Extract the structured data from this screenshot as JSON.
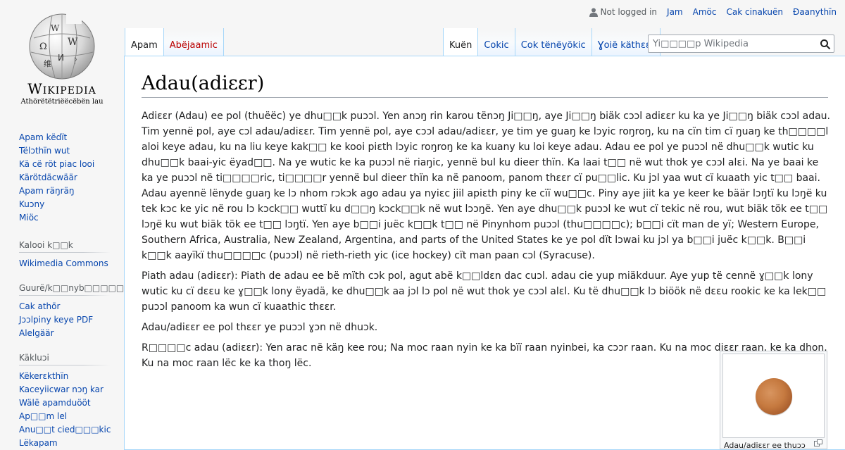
{
  "personal": {
    "not_logged_in": "Not logged in",
    "links": [
      "Jam",
      "Amöc",
      "Cak cinakuën",
      "Ɖaanythïn"
    ]
  },
  "logo": {
    "wordmark": "Wikipedia",
    "tagline": "Athörëtëtriëëcëbën lau"
  },
  "tabs": {
    "left": [
      {
        "label": "Apam",
        "selected": true,
        "new": false
      },
      {
        "label": "Abëjaamic",
        "selected": false,
        "new": true
      }
    ],
    "right": [
      {
        "label": "Kuën",
        "selected": true
      },
      {
        "label": "Cokic",
        "selected": false
      },
      {
        "label": "Cok tënëyökic",
        "selected": false
      },
      {
        "label": "Ɣoië käthɛɛr",
        "selected": false
      }
    ]
  },
  "search": {
    "placeholder": "Yi□□□□p Wikipedia"
  },
  "sidebar": {
    "navigation": [
      "Apam këdït",
      "Tëlɔthïn wut",
      "Kä cë röt piac looi",
      "Kärötdäcwäär",
      "Apam räŋräŋ",
      "Kuɔny",
      "Miöc"
    ],
    "interaction": {
      "heading": "Kalooi k□□k",
      "items": [
        "Wikimedia Commons"
      ]
    },
    "print": {
      "heading": "Guurë/k□□nyb□□□□□ë",
      "items": [
        "Cak athör",
        "Jɔɔlpiny keye PDF",
        "Alelgäär"
      ]
    },
    "tools": {
      "heading": "Käkluɔi",
      "items": [
        "Këkerɛkthïn",
        "Kaceyiicwar nɔŋ kar",
        "Wälë apamduööt",
        "Ap□□m lel",
        "Anu□□t cied□□□kic",
        "Lëkapam"
      ]
    }
  },
  "article": {
    "title": "Adau(adiɛɛr)",
    "paragraphs": [
      "Adiɛɛr (Adau) ee pol (thuëëc) ye dhu□□k puɔɔl. Yen anɔŋ rin karou tënɔŋ Ji□□ŋ, aye Ji□□ŋ biäk cɔɔl adiɛɛr ku ka ye Ji□□ŋ biäk cɔɔl adau. Tim yennë pol, aye cɔl adau/adiɛɛr. Tim yennë pol, aye cɔɔl adau/adiɛɛr, ye tim ye guaŋ ke lɔyic roŋroŋ, ku na cïn tim cï ŋuaŋ ke th□□□□l aloi keye adau, ku na liu keye kak□□ ke kooi piɛth lɔyic roŋroŋ ke ka kuany ku loi keye adau. Adau ee pol ye puɔɔl në dhu□□k wutic ku dhu□□k baai-yic ëyad□□. Na ye wutic ke ka puɔɔl në riaŋic, yennë bul ku dieer thïn. Ka laai t□□ në wut thok ye cɔɔl alɛi. Na ye baai ke ka ye puɔɔl në ti□□□□ric, ti□□□□r yennë bul dieer thïn ka në panoom, panom thɛɛr cï pu□□lic. Ku jɔl yaa wut cï kuaath yic t□□ baai. Adau ayennë lënyde guaŋ ke lɔ nhom rɔkɔk ago adau ya nyiɛc jiil apiɛth piny ke cïï wu□□c. Piny aye jiit ka ye keer ke bäär lɔŋtï ku lɔŋë ku tek kɔc ke yic në rou lɔ kɔck□□ wuttï ku d□□ŋ kɔck□□k në wut lɔɔŋë. Yen aye dhu□□k puɔɔl ke wut cï tekic në rou, wut biäk tök ee t□□ lɔŋë ku wut biäk tök ee t□□ lɔŋtï. Yen aye b□□i juëc k□□k t□□ në Pinynhom puɔɔl (thu□□□□c); b□□i cït man de yï; Western Europe, Southern Africa, Australia, New Zealand, Argentina, and parts of the United States ke ye pol dït lɔwai ku jɔl ya b□□i juëc k□□k. B□□i k□□k aayïkï thu□□□□c (puɔɔl) në rieth-rieth yic (ice hockey) cït man paan cɔl (Syracuse).",
      "Piath adau (adiɛɛr): Piath de adau ee bë mïth cɔk pol, agut abë k□□ldɛn dac cuɔl. adau cie yup miäkduur. Aye yup të cennë ɣ□□k lony wutic ku cï dɛɛu ke ɣ□□k lony ëyadä, ke dhu□□k aa jɔl lɔ pol në wut thok ye cɔɔl alɛl. Ku të dhu□□k lɔ biöök në dɛɛu rookic ke ka lek□□ puɔɔl panoom ka wun cï kuaathic thɛɛr.",
      "Adau/adiɛɛr ee pol thɛɛr ye puɔɔl ɣɔn në dhuɔk.",
      "R□□□□c adau (adiɛɛr): Yen arac në käŋ kee rou; Na moc raan nyin ke ka bïï raan nyinbei, ka cɔɔr raan. Ku na moc diɛɛr raan, ke ka dhoŋ. Ku na moc raan lëc ke ka thoŋ lëc."
    ],
    "thumb_caption": "Adau/adiɛɛr ee thuɔɔ"
  }
}
